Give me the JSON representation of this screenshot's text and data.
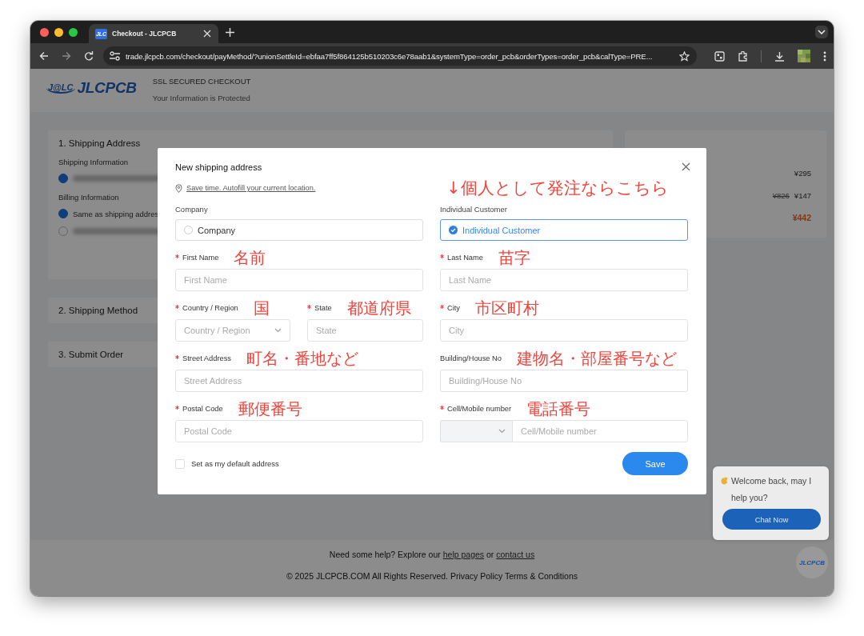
{
  "browser": {
    "tab": {
      "favicon": "JLC",
      "title": "Checkout - JLCPCB",
      "selected": true
    },
    "url": "trade.jlcpcb.com/checkout/payMethod/?unionSettleId=ebfaa7ff5f864125b510203c6e78aab1&systemType=order_pcb&orderTypes=order_pcb&calType=PRE..."
  },
  "header": {
    "logo_mark": "J@LC",
    "logo_text": "JLCPCB",
    "title": "SSL SECURED CHECKOUT",
    "subtitle": "Your Information is Protected"
  },
  "steps": [
    {
      "title": "1. Shipping Address",
      "expanded": true,
      "sections": [
        {
          "heading": "Shipping Information",
          "options": [
            {
              "kind": "blurred",
              "selected": true
            }
          ]
        },
        {
          "heading": "Billing Information",
          "options": [
            {
              "kind": "text",
              "label": "Same as shipping addres",
              "selected": true
            },
            {
              "kind": "blurred",
              "selected": false
            }
          ]
        }
      ]
    },
    {
      "title": "2. Shipping Method",
      "expanded": false
    },
    {
      "title": "3. Submit Order",
      "expanded": false
    }
  ],
  "summary": {
    "rows": [
      {
        "kind": "price",
        "price": "¥295"
      },
      {
        "kind": "discount",
        "old_price": "¥826",
        "price": "¥147"
      },
      {
        "kind": "total",
        "price": "¥442"
      }
    ]
  },
  "modal": {
    "title": "New shipping address",
    "autofill_link": "Save time. Autofill your current location.",
    "customer_note": "↓個人として発注ならこちら",
    "customer_types": [
      {
        "heading": "Company",
        "label": "Company",
        "selected": false
      },
      {
        "heading": "Individual Customer",
        "label": "Individual Customer",
        "selected": true
      }
    ],
    "rows": [
      {
        "fields": [
          {
            "kind": "text",
            "label": "First Name",
            "required": true,
            "note": "名前",
            "placeholder": "First Name"
          },
          {
            "kind": "text",
            "label": "Last Name",
            "required": true,
            "note": "苗字",
            "placeholder": "Last Name"
          }
        ]
      },
      {
        "fields": [
          {
            "kind": "select",
            "label": "Country / Region",
            "required": true,
            "note": "国",
            "placeholder": "Country / Region"
          },
          {
            "kind": "text",
            "label": "State",
            "required": true,
            "note": "都道府県",
            "placeholder": "State"
          },
          {
            "kind": "text",
            "label": "City",
            "required": true,
            "note": "市区町村",
            "placeholder": "City"
          }
        ]
      },
      {
        "fields": [
          {
            "kind": "text",
            "label": "Street Address",
            "required": true,
            "note": "町名・番地など",
            "placeholder": "Street Address"
          },
          {
            "kind": "text",
            "label": "Building/House No",
            "required": false,
            "note": "建物名・部屋番号など",
            "placeholder": "Building/House No"
          }
        ]
      },
      {
        "fields": [
          {
            "kind": "text",
            "label": "Postal Code",
            "required": true,
            "note": "郵便番号",
            "placeholder": "Postal Code"
          },
          {
            "kind": "phone",
            "label": "Cell/Mobile number",
            "required": true,
            "note": "電話番号",
            "placeholder": "Cell/Mobile number"
          }
        ]
      }
    ],
    "default_checkbox": {
      "label": "Set as my default address",
      "checked": false
    },
    "save_button": "Save"
  },
  "chat": {
    "message": "Welcome back, may I help you?",
    "button": "Chat Now",
    "avatar": "JLCPCB"
  },
  "footer": {
    "help_prefix": "Need some help? Explore our",
    "help_link": "help pages",
    "help_joiner": "or",
    "contact_link": "contact us",
    "copyright": "© 2025 JLCPCB.COM All Rights Reserved. Privacy Policy Terms & Conditions"
  }
}
